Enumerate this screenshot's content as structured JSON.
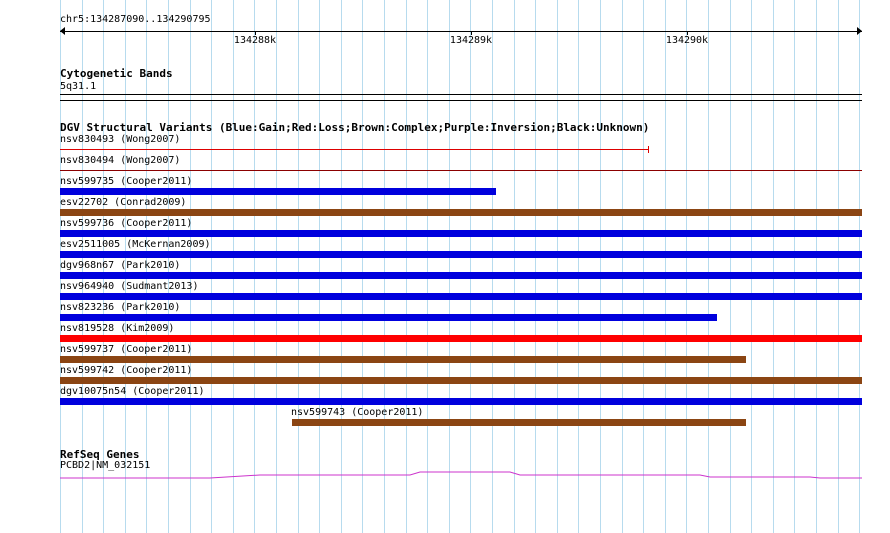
{
  "locus": "chr5:134287090..134290795",
  "ruler": {
    "labels": [
      "134288k",
      "134289k",
      "134290k"
    ]
  },
  "cytoband": {
    "title": "Cytogenetic Bands",
    "band": "5q31.1"
  },
  "dgv": {
    "title": "DGV Structural Variants (Blue:Gain;Red:Loss;Brown:Complex;Purple:Inversion;Black:Unknown)",
    "colors": {
      "gain": "#0000dd",
      "loss": "#ff0000",
      "complex": "#8b4513",
      "lossline": "#cc0000"
    },
    "variants": [
      {
        "label": "nsv830493 (Wong2007)",
        "type": "loss-thin"
      },
      {
        "label": "nsv830494 (Wong2007)",
        "type": "loss-thin-dark"
      },
      {
        "label": "nsv599735 (Cooper2011)",
        "type": "gain"
      },
      {
        "label": "esv22702 (Conrad2009)",
        "type": "complex"
      },
      {
        "label": "nsv599736 (Cooper2011)",
        "type": "gain"
      },
      {
        "label": "esv2511005 (McKernan2009)",
        "type": "gain"
      },
      {
        "label": "dgv968n67 (Park2010)",
        "type": "gain"
      },
      {
        "label": "nsv964940 (Sudmant2013)",
        "type": "gain"
      },
      {
        "label": "nsv823236 (Park2010)",
        "type": "gain"
      },
      {
        "label": "nsv819528 (Kim2009)",
        "type": "loss"
      },
      {
        "label": "nsv599737 (Cooper2011)",
        "type": "complex"
      },
      {
        "label": "nsv599742 (Cooper2011)",
        "type": "complex"
      },
      {
        "label": "dgv10075n54 (Cooper2011)",
        "type": "gain"
      },
      {
        "label": "nsv599743 (Cooper2011)",
        "type": "complex"
      }
    ]
  },
  "refseq": {
    "title": "RefSeq Genes",
    "gene": "PCBD2|NM_032151",
    "color": "#cc33cc"
  }
}
